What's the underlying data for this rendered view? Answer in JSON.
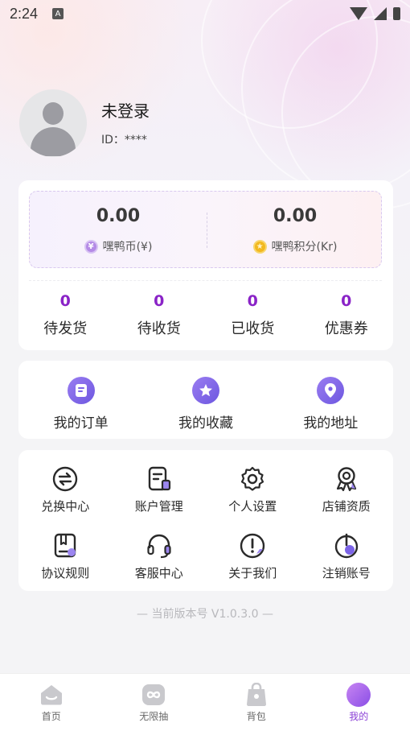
{
  "status_bar": {
    "time": "2:24",
    "notif_icon": "A"
  },
  "profile": {
    "name": "未登录",
    "id_text": "ID：****"
  },
  "wallet": {
    "coins": {
      "value": "0.00",
      "label": "嘿鸭币(¥)",
      "icon": "yen-coin-icon"
    },
    "points": {
      "value": "0.00",
      "label": "嘿鸭积分(Kr)",
      "icon": "star-coin-icon"
    }
  },
  "orders": [
    {
      "count": "0",
      "label": "待发货"
    },
    {
      "count": "0",
      "label": "待收货"
    },
    {
      "count": "0",
      "label": "已收货"
    },
    {
      "count": "0",
      "label": "优惠券"
    }
  ],
  "quick_links": [
    {
      "label": "我的订单",
      "icon": "order-icon"
    },
    {
      "label": "我的收藏",
      "icon": "favorite-icon"
    },
    {
      "label": "我的地址",
      "icon": "location-icon"
    }
  ],
  "services": [
    {
      "label": "兑换中心",
      "icon": "exchange-icon"
    },
    {
      "label": "账户管理",
      "icon": "account-icon"
    },
    {
      "label": "个人设置",
      "icon": "settings-icon"
    },
    {
      "label": "店铺资质",
      "icon": "certificate-icon"
    },
    {
      "label": "协议规则",
      "icon": "agreement-icon"
    },
    {
      "label": "客服中心",
      "icon": "headset-icon"
    },
    {
      "label": "关于我们",
      "icon": "info-icon"
    },
    {
      "label": "注销账号",
      "icon": "power-icon"
    }
  ],
  "version": "— 当前版本号 V1.0.3.0 —",
  "bottom_nav": [
    {
      "label": "首页",
      "icon": "home-icon"
    },
    {
      "label": "无限抽",
      "icon": "infinity-icon"
    },
    {
      "label": "背包",
      "icon": "bag-icon"
    },
    {
      "label": "我的",
      "icon": "profile-icon"
    }
  ],
  "colors": {
    "accent": "#8a23c7",
    "icon_gradient_start": "#9a7df1",
    "icon_gradient_end": "#6d57e0"
  }
}
